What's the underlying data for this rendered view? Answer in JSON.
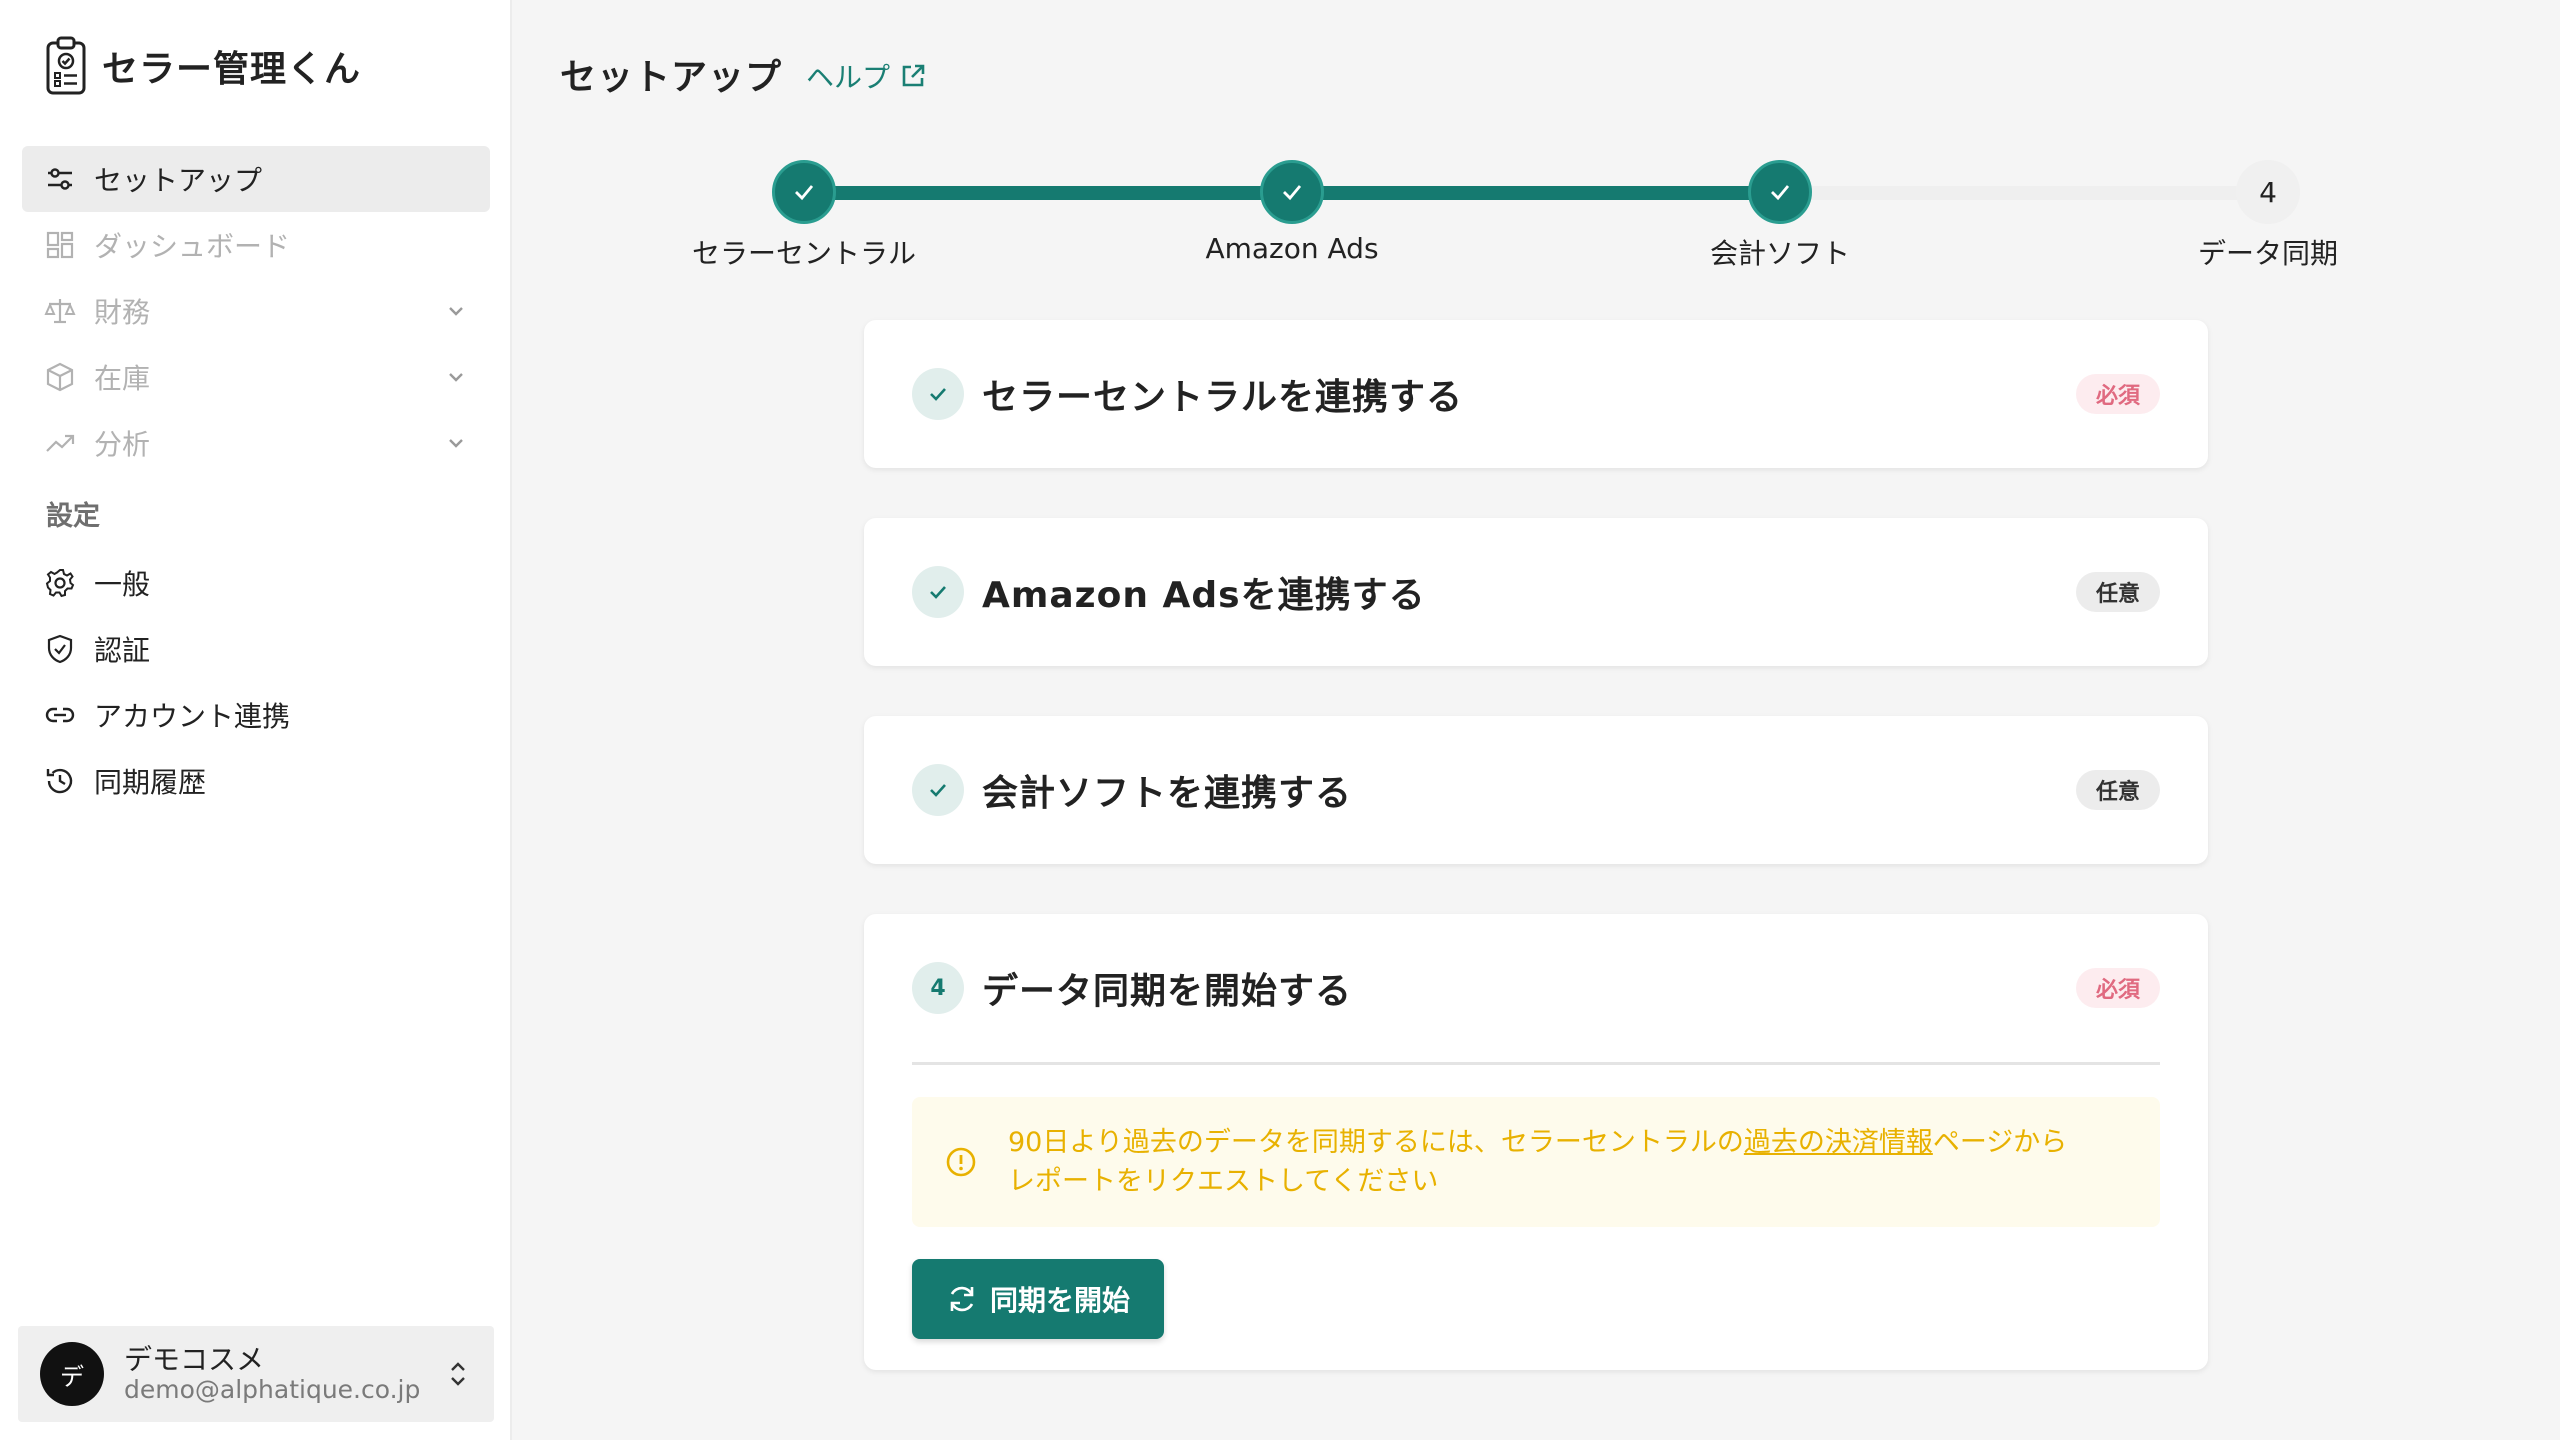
{
  "app": {
    "name": "セラー管理くん"
  },
  "sidebar": {
    "items": [
      {
        "label": "セットアップ",
        "icon": "sliders-icon",
        "active": true
      },
      {
        "label": "ダッシュボード",
        "icon": "dashboard-grid-icon",
        "disabled": true
      },
      {
        "label": "財務",
        "icon": "scale-icon",
        "disabled": true,
        "expandable": true
      },
      {
        "label": "在庫",
        "icon": "box-icon",
        "disabled": true,
        "expandable": true
      },
      {
        "label": "分析",
        "icon": "trend-up-icon",
        "disabled": true,
        "expandable": true
      }
    ],
    "section_label": "設定",
    "settings_items": [
      {
        "label": "一般",
        "icon": "gear-icon"
      },
      {
        "label": "認証",
        "icon": "shield-icon"
      },
      {
        "label": "アカウント連携",
        "icon": "link-icon"
      },
      {
        "label": "同期履歴",
        "icon": "history-icon"
      }
    ],
    "user": {
      "avatar_initial": "デ",
      "name": "デモコスメ",
      "email": "demo@alphatique.co.jp"
    }
  },
  "header": {
    "title": "セットアップ",
    "help_label": "ヘルプ"
  },
  "stepper": {
    "steps": [
      {
        "label": "セラーセントラル",
        "status": "done"
      },
      {
        "label": "Amazon Ads",
        "status": "done"
      },
      {
        "label": "会計ソフト",
        "status": "done"
      },
      {
        "label": "データ同期",
        "status": "todo",
        "number": "4"
      }
    ]
  },
  "cards": [
    {
      "title": "セラーセントラルを連携する",
      "badge": "必須",
      "status": "done"
    },
    {
      "title": "Amazon Adsを連携する",
      "badge": "任意",
      "status": "done"
    },
    {
      "title": "会計ソフトを連携する",
      "badge": "任意",
      "status": "done"
    },
    {
      "title": "データ同期を開始する",
      "badge": "必須",
      "status": "todo",
      "number": "4"
    }
  ],
  "notice": {
    "text_before": "90日より過去のデータを同期するには、セラーセントラルの",
    "link_text": "過去の決済情報",
    "text_after_line1": "ページから",
    "text_line2": "レポートをリクエストしてください"
  },
  "sync_button": {
    "label": "同期を開始"
  },
  "colors": {
    "accent": "#157a70",
    "required_badge": "#e06a80",
    "notice_text": "#e8b100"
  }
}
